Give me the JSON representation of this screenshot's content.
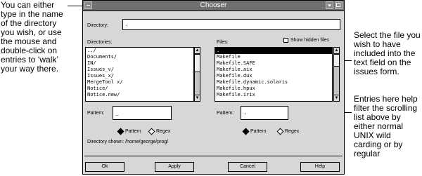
{
  "callouts": {
    "left": [
      "You can either",
      "type in the name",
      "of the directory",
      "you wish, or use",
      "the mouse and",
      "double-click on",
      "entries to ‘walk’",
      "your way there."
    ],
    "right_top": [
      "Select the file you",
      "wish to have",
      "included into the",
      "text field on the",
      "issues form."
    ],
    "right_bottom": [
      "Entries here help",
      "filter the scrolling",
      "list above by",
      "either normal",
      "UNIX wild",
      "carding or by",
      "regular"
    ]
  },
  "window": {
    "title": "Chooser"
  },
  "directory": {
    "label": "Directory:",
    "value": "."
  },
  "directories": {
    "label": "Directories:",
    "items": [
      "../",
      "Documents/",
      "IN/",
      "Issues_v/",
      "Issues_x/",
      "MergeTool x/",
      "Notice/",
      "Notice.new/"
    ]
  },
  "files": {
    "label": "Files:",
    "show_hidden_label": "Show hidden files",
    "items": [
      ".",
      "Makefile",
      "Makefile.SAFE",
      "Makefile.aix",
      "Makefile.dux",
      "Makefile.dynamic.solaris",
      "Makefile.hpux",
      "Makefile.irix"
    ],
    "selected_index": 0
  },
  "dir_filter": {
    "label": "Pattern:",
    "value": "_",
    "pattern_label": "Pattern",
    "regex_label": "Regex"
  },
  "file_filter": {
    "label": "Pattern:",
    "value": ".",
    "pattern_label": "Pattern",
    "regex_label": "Regex"
  },
  "status": {
    "text": "Directory shown: /home/george/prog/"
  },
  "buttons": {
    "ok": "Ok",
    "apply": "Apply",
    "cancel": "Cancel",
    "help": "Help"
  }
}
